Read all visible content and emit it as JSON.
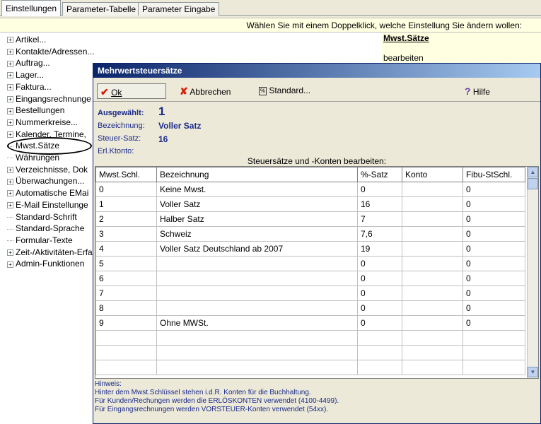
{
  "tabs": [
    {
      "label": "Einstellungen",
      "active": true
    },
    {
      "label": "Parameter-Tabelle",
      "active": false
    },
    {
      "label": "Parameter Eingabe",
      "active": false
    }
  ],
  "hint": "Wählen Sie mit einem Doppelklick, welche Einstellung Sie ändern wollen:",
  "right_pane": {
    "title": "Mwst.Sätze",
    "action": "bearbeiten"
  },
  "tree": [
    {
      "label": "Artikel...",
      "expandable": true
    },
    {
      "label": "Kontakte/Adressen...",
      "expandable": true
    },
    {
      "label": "Auftrag...",
      "expandable": true
    },
    {
      "label": "Lager...",
      "expandable": true
    },
    {
      "label": "Faktura...",
      "expandable": true
    },
    {
      "label": "Eingangsrechnunge",
      "expandable": true
    },
    {
      "label": "Bestellungen",
      "expandable": true
    },
    {
      "label": "Nummerkreise...",
      "expandable": true
    },
    {
      "label": "Kalender, Termine,",
      "expandable": true
    },
    {
      "label": "Mwst.Sätze",
      "expandable": false
    },
    {
      "label": "Währungen",
      "expandable": false
    },
    {
      "label": "Verzeichnisse, Dok",
      "expandable": true
    },
    {
      "label": "Überwachungen...",
      "expandable": true
    },
    {
      "label": "Automatische EMai",
      "expandable": true
    },
    {
      "label": "E-Mail Einstellunge",
      "expandable": true
    },
    {
      "label": "Standard-Schrift",
      "expandable": false
    },
    {
      "label": "Standard-Sprache",
      "expandable": false
    },
    {
      "label": "Formular-Texte",
      "expandable": false
    },
    {
      "label": "Zeit-/Aktivitäten-Erfa",
      "expandable": true
    },
    {
      "label": "Admin-Funktionen",
      "expandable": true
    }
  ],
  "dialog": {
    "title": "Mehrwertsteuersätze",
    "toolbar": {
      "ok_label": "Ok",
      "cancel_label": "Abbrechen",
      "standard_label": "Standard...",
      "help_label": "Hilfe"
    },
    "fields": {
      "selected_label": "Ausgewählt:",
      "selected_value": "1",
      "name_label": "Bezeichnung:",
      "name_value": "Voller Satz",
      "rate_label": "Steuer-Satz:",
      "rate_value": "16",
      "account_label": "Erl.Ktonto:"
    },
    "grid_title": "Steuersätze und -Konten bearbeiten:",
    "columns": [
      "Mwst.Schl.",
      "Bezeichnung",
      "%-Satz",
      "Konto",
      "Fibu-StSchl."
    ],
    "rows": [
      [
        "0",
        "Keine Mwst.",
        "0",
        "",
        "0"
      ],
      [
        "1",
        "Voller Satz",
        "16",
        "",
        "0"
      ],
      [
        "2",
        "Halber Satz",
        "7",
        "",
        "0"
      ],
      [
        "3",
        "Schweiz",
        "7,6",
        "",
        "0"
      ],
      [
        "4",
        "Voller Satz Deutschland ab 2007",
        "19",
        "",
        "0"
      ],
      [
        "5",
        "",
        "0",
        "",
        "0"
      ],
      [
        "6",
        "",
        "0",
        "",
        "0"
      ],
      [
        "7",
        "",
        "0",
        "",
        "0"
      ],
      [
        "8",
        "",
        "0",
        "",
        "0"
      ],
      [
        "9",
        "Ohne MWSt.",
        "0",
        "",
        "0"
      ],
      [
        "",
        "",
        "",
        "",
        ""
      ],
      [
        "",
        "",
        "",
        "",
        ""
      ],
      [
        "",
        "",
        "",
        "",
        ""
      ]
    ],
    "notes": [
      "Hinweis:",
      "Hinter dem Mwst.Schlüssel stehen i.d.R. Konten für die Buchhaltung.",
      "Für Kunden/Rechungen werden die ERLÖSKONTEN verwendet (4100-4499).",
      "Für Eingangsrechnungen werden VORSTEUER-Konten verwendet (54xx)."
    ]
  }
}
